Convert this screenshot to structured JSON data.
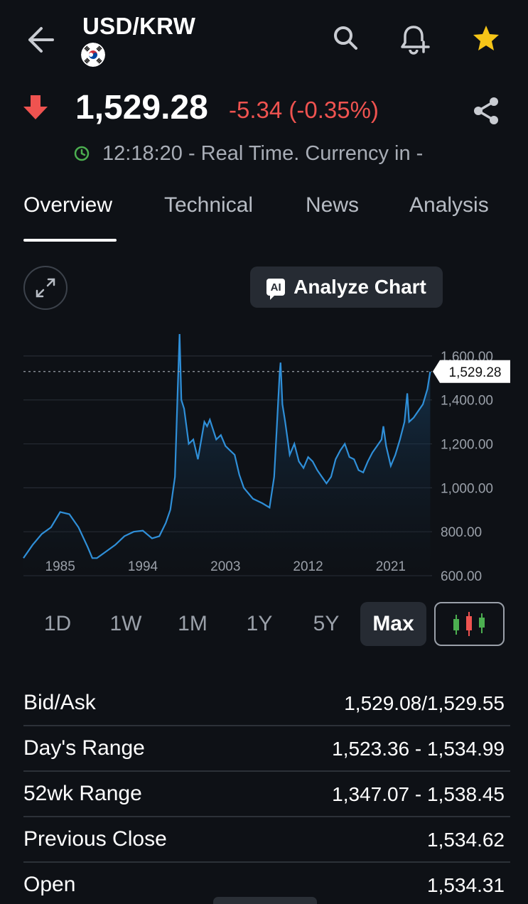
{
  "header": {
    "title": "USD/KRW",
    "back_icon": "arrow-left-icon",
    "flag_icon": "south-korea-flag-icon",
    "search_icon": "search-icon",
    "alert_icon": "bell-plus-icon",
    "watchlist_icon": "star-icon",
    "accent_star": "#f5c518"
  },
  "quote": {
    "price": "1,529.28",
    "change": "-5.34 (-0.35%)",
    "direction_icon": "arrow-down-icon",
    "down_color": "#ef5350",
    "share_icon": "share-icon",
    "time_text": "12:18:20 - Real Time. Currency in -",
    "live_color": "#4caf50"
  },
  "tabs": [
    {
      "label": "Overview",
      "active": true
    },
    {
      "label": "Technical",
      "active": false
    },
    {
      "label": "News",
      "active": false
    },
    {
      "label": "Analysis",
      "active": false
    }
  ],
  "chart_controls": {
    "expand_icon": "expand-icon",
    "analyze_badge": "AI",
    "analyze_label": "Analyze Chart"
  },
  "chart_data": {
    "type": "area",
    "current_label": "1,529.28",
    "current_value": 1529.28,
    "ylim": [
      600,
      1700
    ],
    "y_ticks": [
      {
        "value": 1600,
        "label": "1,600.00"
      },
      {
        "value": 1400,
        "label": "1,400.00"
      },
      {
        "value": 1200,
        "label": "1,200.00"
      },
      {
        "value": 1000,
        "label": "1,000.00"
      },
      {
        "value": 800,
        "label": "800.00"
      },
      {
        "value": 600,
        "label": "600.00"
      }
    ],
    "xlim": [
      1981,
      2025.5
    ],
    "x_ticks": [
      {
        "value": 1985,
        "label": "1985"
      },
      {
        "value": 1994,
        "label": "1994"
      },
      {
        "value": 2003,
        "label": "2003"
      },
      {
        "value": 2012,
        "label": "2012"
      },
      {
        "value": 2021,
        "label": "2021"
      }
    ],
    "line_color": "#2f8fd8",
    "x": [
      1981.0,
      1982.0,
      1983.0,
      1984.0,
      1985.0,
      1986.0,
      1987.0,
      1988.0,
      1988.5,
      1989.0,
      1990.0,
      1991.0,
      1992.0,
      1993.0,
      1994.0,
      1995.0,
      1995.8,
      1996.5,
      1997.0,
      1997.5,
      1997.8,
      1998.0,
      1998.2,
      1998.5,
      1999.0,
      1999.5,
      2000.0,
      2000.7,
      2001.0,
      2001.3,
      2002.0,
      2002.5,
      2003.0,
      2003.5,
      2004.0,
      2004.5,
      2005.0,
      2006.0,
      2007.0,
      2007.8,
      2008.3,
      2008.6,
      2008.9,
      2009.0,
      2009.2,
      2009.5,
      2010.0,
      2010.5,
      2011.0,
      2011.5,
      2012.0,
      2012.5,
      2013.0,
      2013.5,
      2014.0,
      2014.5,
      2015.0,
      2015.5,
      2016.0,
      2016.5,
      2017.0,
      2017.5,
      2018.0,
      2018.5,
      2019.0,
      2019.5,
      2020.0,
      2020.2,
      2020.5,
      2021.0,
      2021.5,
      2022.0,
      2022.5,
      2022.8,
      2023.0,
      2023.5,
      2024.0,
      2024.5,
      2025.0,
      2025.3
    ],
    "values": [
      680,
      740,
      790,
      820,
      890,
      880,
      820,
      730,
      680,
      680,
      710,
      740,
      780,
      800,
      805,
      770,
      780,
      840,
      900,
      1050,
      1450,
      1700,
      1400,
      1360,
      1200,
      1220,
      1130,
      1300,
      1280,
      1310,
      1220,
      1240,
      1190,
      1170,
      1150,
      1060,
      1000,
      950,
      930,
      910,
      1050,
      1280,
      1520,
      1570,
      1380,
      1300,
      1150,
      1200,
      1120,
      1090,
      1140,
      1120,
      1080,
      1050,
      1020,
      1050,
      1130,
      1170,
      1200,
      1140,
      1130,
      1080,
      1070,
      1120,
      1160,
      1190,
      1220,
      1280,
      1190,
      1100,
      1150,
      1220,
      1300,
      1430,
      1300,
      1320,
      1350,
      1380,
      1450,
      1529
    ]
  },
  "ranges": [
    {
      "label": "1D",
      "active": false
    },
    {
      "label": "1W",
      "active": false
    },
    {
      "label": "1M",
      "active": false
    },
    {
      "label": "1Y",
      "active": false
    },
    {
      "label": "5Y",
      "active": false
    },
    {
      "label": "Max",
      "active": true
    }
  ],
  "candle_icon": "candlestick-chart-icon",
  "stats": [
    {
      "label": "Bid/Ask",
      "value": "1,529.08/1,529.55"
    },
    {
      "label": "Day's Range",
      "value": "1,523.36 - 1,534.99"
    },
    {
      "label": "52wk Range",
      "value": "1,347.07 - 1,538.45"
    },
    {
      "label": "Previous Close",
      "value": "1,534.62"
    },
    {
      "label": "Open",
      "value": "1,534.31"
    }
  ]
}
